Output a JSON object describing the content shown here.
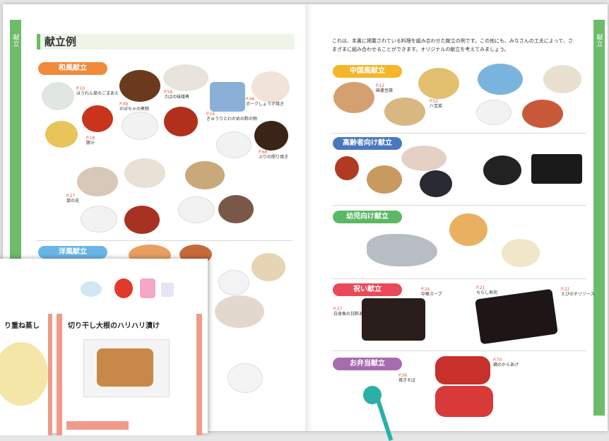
{
  "left_page": {
    "edge_label": "献立",
    "title": "献立例",
    "sections": [
      {
        "label": "和風献立",
        "color": "#f08a3a"
      },
      {
        "label": "洋風献立",
        "color": "#69b6e6"
      }
    ]
  },
  "right_page": {
    "edge_label": "献立",
    "intro": "これは、本書に掲載されている料理を組み合わせた献立の例です。この他にも、みなさんの工夫によって、さまざまに組み合わせることができます。オリジナルの献立を考えてみましょう。",
    "sections": [
      {
        "label": "中国風献立",
        "color": "#f5b62a"
      },
      {
        "label": "高齢者向け献立",
        "color": "#4a78c0"
      },
      {
        "label": "幼児向け献立",
        "color": "#5cb864"
      },
      {
        "label": "祝い献立",
        "color": "#e84a5a"
      },
      {
        "label": "お弁当献立",
        "color": "#a76bb0"
      }
    ]
  },
  "captions": {
    "c1": {
      "page": "P.10",
      "name": "ほうれん草のごまあえ"
    },
    "c2": {
      "page": "P.09",
      "name": "かぼちゃの煮物"
    },
    "c3": {
      "page": "P.56",
      "name": "さばの味噌煮"
    },
    "c4": {
      "page": "P.16",
      "name": "きゅうりとわかめの酢の物"
    },
    "c5": {
      "page": "P.46",
      "name": "ポークしょうが焼き"
    },
    "c6": {
      "page": "P.18",
      "name": "豚汁"
    },
    "c7": {
      "page": "P.68",
      "name": "ぶりの照り焼き"
    },
    "c8": {
      "page": "P.27",
      "name": "菜の花"
    },
    "c9": {
      "page": "P.12",
      "name": "麻婆豆腐"
    },
    "c10": {
      "page": "P.27",
      "name": "ちくわの甘辛煮"
    },
    "c11": {
      "page": "P.52",
      "name": "八宝菜"
    },
    "c12": {
      "page": "P.24",
      "name": "中華スープ"
    },
    "c13": {
      "page": "P.37",
      "name": "白身魚の甘酢あん"
    },
    "c14": {
      "page": "P.21",
      "name": "ちらし寿司"
    },
    "c15": {
      "page": "P.22",
      "name": "えびのチリソース"
    },
    "c16": {
      "page": "P.36",
      "name": "焼きそば"
    },
    "c17": {
      "page": "P.70",
      "name": "鶏のからあげ"
    }
  },
  "card": {
    "left_title": "り重ね蒸し",
    "right_title": "切り干し大根のハリハリ漬け"
  }
}
